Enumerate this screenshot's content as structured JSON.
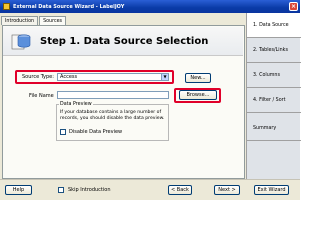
{
  "window": {
    "title": "External Data Source Wizard - LabelJOY"
  },
  "tabs": [
    {
      "label": "Introduction"
    },
    {
      "label": "Sources"
    }
  ],
  "header": {
    "title": "Step 1. Data Source Selection"
  },
  "form": {
    "source_type_label": "Source Type:",
    "source_type_value": "Access",
    "new_button": "New...",
    "file_name_label": "File Name",
    "file_name_value": "",
    "browse_button": "Browse..."
  },
  "preview": {
    "legend": "Data Preview",
    "description": "If your database contains a large number of records, you should disable the data preview.",
    "disable_label": "Disable Data Preview"
  },
  "steps": [
    {
      "label": "1. Data Source"
    },
    {
      "label": "2. Tables/Links"
    },
    {
      "label": "3. Columns"
    },
    {
      "label": "4. Filter / Sort"
    },
    {
      "label": "Summary"
    }
  ],
  "footer": {
    "help_button": "Help",
    "skip_intro_label": "Skip Introduction",
    "back_button": "< Back",
    "next_button": "Next >",
    "exit_button": "Exit Wizard"
  }
}
